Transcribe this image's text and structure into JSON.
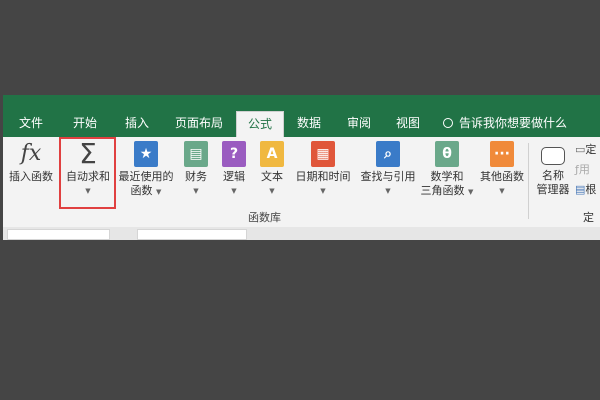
{
  "tabs": [
    {
      "label": "文件"
    },
    {
      "label": "开始"
    },
    {
      "label": "插入"
    },
    {
      "label": "页面布局"
    },
    {
      "label": "公式",
      "active": true
    },
    {
      "label": "数据"
    },
    {
      "label": "审阅"
    },
    {
      "label": "视图"
    }
  ],
  "search": {
    "placeholder": "告诉我你想要做什么"
  },
  "ribbon": {
    "insert_function": {
      "icon": "fx",
      "label": "插入函数"
    },
    "autosum": {
      "icon": "Σ",
      "label": "自动求和"
    },
    "recent": {
      "line1": "最近使用的",
      "line2": "函数"
    },
    "financial": {
      "label": "财务"
    },
    "logical": {
      "icon": "?",
      "label": "逻辑"
    },
    "text": {
      "icon": "A",
      "label": "文本"
    },
    "datetime": {
      "label": "日期和时间"
    },
    "lookup": {
      "label": "查找与引用"
    },
    "math": {
      "icon": "θ",
      "line1": "数学和",
      "line2": "三角函数"
    },
    "other": {
      "icon": "···",
      "label": "其他函数"
    },
    "name_manager": {
      "line1": "名称",
      "line2": "管理器"
    },
    "define_name": "定",
    "use_formula": "用",
    "create": "根",
    "group_library": "函数库",
    "group_defined": "定义"
  },
  "colors": {
    "accent": "#217346",
    "highlight": "#e04040"
  }
}
